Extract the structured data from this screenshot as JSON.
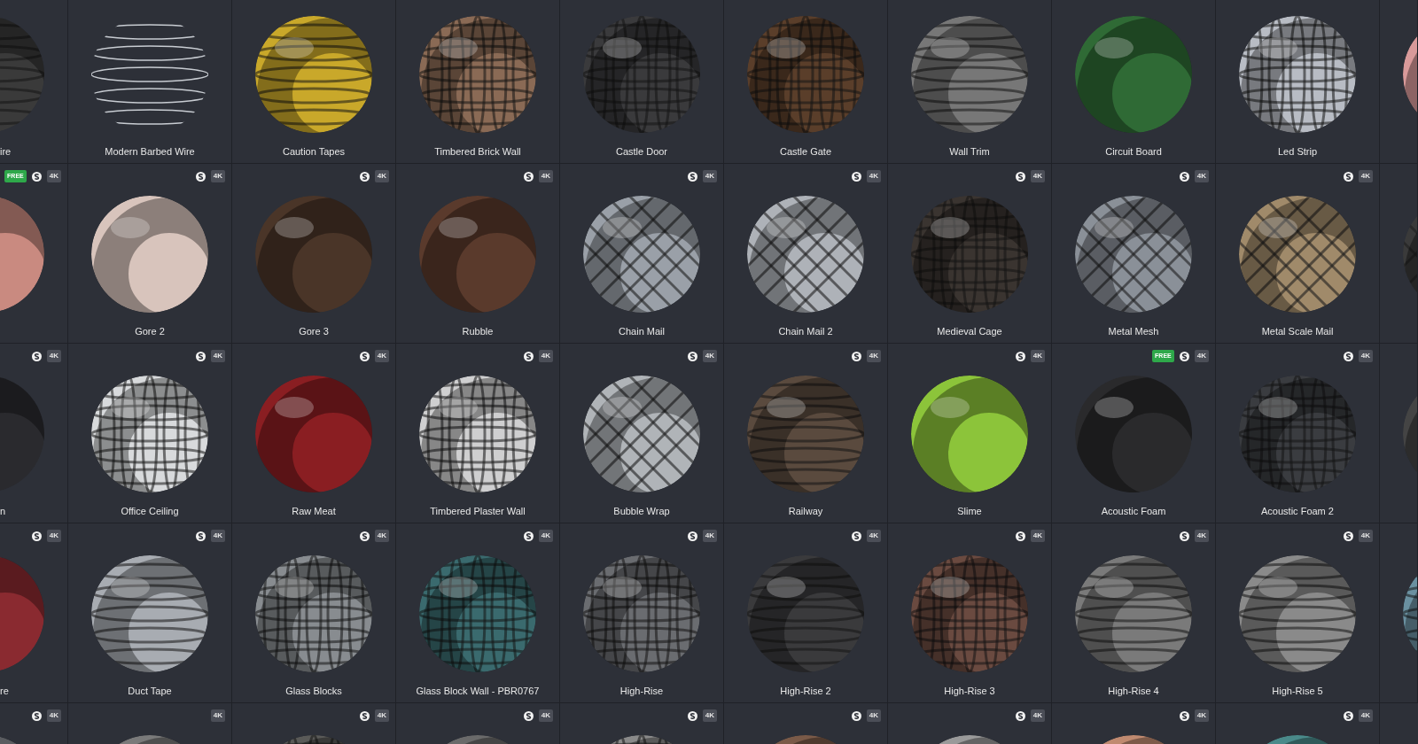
{
  "rows": [
    {
      "tiles": [
        {
          "kind": "picture",
          "label": "ire"
        },
        {
          "kind": "picture",
          "label": "Modern Barbed Wire"
        },
        {
          "kind": "picture",
          "label": "Caution Tapes"
        },
        {
          "kind": "picture",
          "label": "Timbered Brick Wall"
        },
        {
          "kind": "picture",
          "label": "Castle Door"
        },
        {
          "kind": "picture",
          "label": "Castle Gate"
        },
        {
          "kind": "picture",
          "label": "Wall Trim"
        },
        {
          "kind": "picture",
          "label": "Circuit Board"
        },
        {
          "kind": "picture",
          "label": "Led Strip"
        },
        {
          "kind": "picture"
        }
      ]
    },
    {
      "tiles": [
        {
          "kind": "picture",
          "tag": "FREE",
          "substance": true,
          "resolution": "4K"
        },
        {
          "kind": "picture",
          "label": "Gore 2",
          "substance": true,
          "resolution": "4K"
        },
        {
          "kind": "picture",
          "label": "Gore 3",
          "substance": true,
          "resolution": "4K"
        },
        {
          "kind": "picture",
          "label": "Rubble",
          "substance": true,
          "resolution": "4K"
        },
        {
          "kind": "picture",
          "label": "Chain Mail",
          "substance": true,
          "resolution": "4K"
        },
        {
          "kind": "picture",
          "label": "Chain Mail 2",
          "substance": true,
          "resolution": "4K"
        },
        {
          "kind": "picture",
          "label": "Medieval Cage",
          "substance": true,
          "resolution": "4K"
        },
        {
          "kind": "picture",
          "label": "Metal Mesh",
          "substance": true,
          "resolution": "4K"
        },
        {
          "kind": "picture",
          "label": "Metal Scale Mail",
          "substance": true,
          "resolution": "4K"
        },
        {
          "kind": "picture"
        }
      ]
    },
    {
      "tiles": [
        {
          "kind": "picture",
          "label": "n",
          "substance": true,
          "resolution": "4K"
        },
        {
          "kind": "picture",
          "label": "Office Ceiling",
          "substance": true,
          "resolution": "4K"
        },
        {
          "kind": "picture",
          "label": "Raw Meat",
          "substance": true,
          "resolution": "4K"
        },
        {
          "kind": "picture",
          "label": "Timbered Plaster Wall",
          "substance": true,
          "resolution": "4K"
        },
        {
          "kind": "picture",
          "label": "Bubble Wrap",
          "substance": true,
          "resolution": "4K"
        },
        {
          "kind": "picture",
          "label": "Railway",
          "substance": true,
          "resolution": "4K"
        },
        {
          "kind": "picture",
          "label": "Slime",
          "substance": true,
          "resolution": "4K"
        },
        {
          "kind": "picture",
          "label": "Acoustic Foam",
          "tag": "FREE",
          "substance": true,
          "resolution": "4K"
        },
        {
          "kind": "picture",
          "label": "Acoustic Foam 2",
          "substance": true,
          "resolution": "4K"
        },
        {
          "kind": "picture"
        }
      ]
    },
    {
      "tiles": [
        {
          "kind": "picture",
          "label": "re",
          "substance": true,
          "resolution": "4K"
        },
        {
          "kind": "picture",
          "label": "Duct Tape",
          "substance": true,
          "resolution": "4K"
        },
        {
          "kind": "picture",
          "label": "Glass Blocks",
          "substance": true,
          "resolution": "4K"
        },
        {
          "kind": "picture",
          "label": "Glass Block Wall - PBR0767",
          "substance": true,
          "resolution": "4K"
        },
        {
          "kind": "picture",
          "label": "High-Rise",
          "substance": true,
          "resolution": "4K"
        },
        {
          "kind": "picture",
          "label": "High-Rise 2",
          "substance": true,
          "resolution": "4K"
        },
        {
          "kind": "picture",
          "label": "High-Rise 3",
          "substance": true,
          "resolution": "4K"
        },
        {
          "kind": "picture",
          "label": "High-Rise 4",
          "substance": true,
          "resolution": "4K"
        },
        {
          "kind": "picture",
          "label": "High-Rise 5",
          "substance": true,
          "resolution": "4K"
        },
        {
          "kind": "picture"
        }
      ]
    },
    {
      "tiles": [
        {
          "kind": "picture",
          "substance": true,
          "resolution": "4K"
        },
        {
          "kind": "picture",
          "substance": false,
          "resolution": "4K"
        },
        {
          "kind": "picture",
          "substance": true,
          "resolution": "4K"
        },
        {
          "kind": "picture",
          "substance": true,
          "resolution": "4K"
        },
        {
          "kind": "picture",
          "substance": true,
          "resolution": "4K"
        },
        {
          "kind": "picture",
          "substance": true,
          "resolution": "4K"
        },
        {
          "kind": "picture",
          "substance": true,
          "resolution": "4K"
        },
        {
          "kind": "picture",
          "substance": true,
          "resolution": "4K"
        },
        {
          "kind": "picture",
          "substance": true,
          "resolution": "4K"
        }
      ]
    }
  ]
}
